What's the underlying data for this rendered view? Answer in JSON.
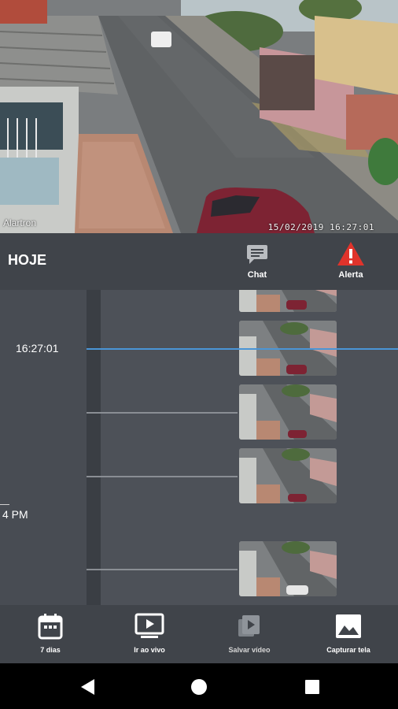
{
  "camera": {
    "label": "Alartron",
    "timestamp": "15/02/2019  16:27:01"
  },
  "header": {
    "today_label": "HOJE",
    "chat_label": "Chat",
    "chat_icon": "chat-icon",
    "alert_label": "Alerta",
    "alert_icon": "warning-triangle-icon",
    "alert_color": "#e0332b"
  },
  "timeline": {
    "current_time": "16:27:01",
    "hour_marker": "4 PM",
    "now_line_color": "#4a95d6",
    "clips": [
      {
        "name": "clip-1"
      },
      {
        "name": "clip-2"
      },
      {
        "name": "clip-3"
      },
      {
        "name": "clip-4"
      },
      {
        "name": "clip-5"
      }
    ]
  },
  "actions": [
    {
      "label": "7 dias",
      "icon": "calendar-icon"
    },
    {
      "label": "Ir ao vivo",
      "icon": "live-play-icon"
    },
    {
      "label": "Salvar vídeo",
      "icon": "save-video-icon"
    },
    {
      "label": "Capturar tela",
      "icon": "image-capture-icon"
    }
  ],
  "system_nav": {
    "back_icon": "back-triangle-icon",
    "home_icon": "home-circle-icon",
    "recents_icon": "recents-square-icon"
  }
}
